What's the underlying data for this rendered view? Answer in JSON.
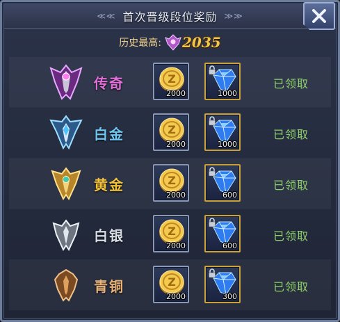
{
  "header": {
    "title": "首次晋级段位奖励",
    "left_deco": "≪≪",
    "right_deco": "≫≫"
  },
  "history": {
    "label": "历史最高:",
    "value": "2035",
    "icon": "legend-rank-small-icon"
  },
  "rows": [
    {
      "name": "传奇",
      "icon": "legend-rank-icon",
      "color": "#e070d8",
      "coin": "2000",
      "gem": "1000",
      "status": "已领取"
    },
    {
      "name": "白金",
      "icon": "platinum-rank-icon",
      "color": "#6ec8f2",
      "coin": "2000",
      "gem": "1000",
      "status": "已领取"
    },
    {
      "name": "黄金",
      "icon": "gold-rank-icon",
      "color": "#f2c23c",
      "coin": "2000",
      "gem": "600",
      "status": "已领取"
    },
    {
      "name": "白银",
      "icon": "silver-rank-icon",
      "color": "#d8dde6",
      "coin": "2000",
      "gem": "600",
      "status": "已领取"
    },
    {
      "name": "青铜",
      "icon": "bronze-rank-icon",
      "color": "#e6b27a",
      "coin": "2000",
      "gem": "300",
      "status": "已领取"
    }
  ],
  "colors": {
    "status": "#8ed06a",
    "history_value": "#f3c54a",
    "coin_frame": "#8a98b8",
    "gem_frame": "#c9a33a"
  }
}
